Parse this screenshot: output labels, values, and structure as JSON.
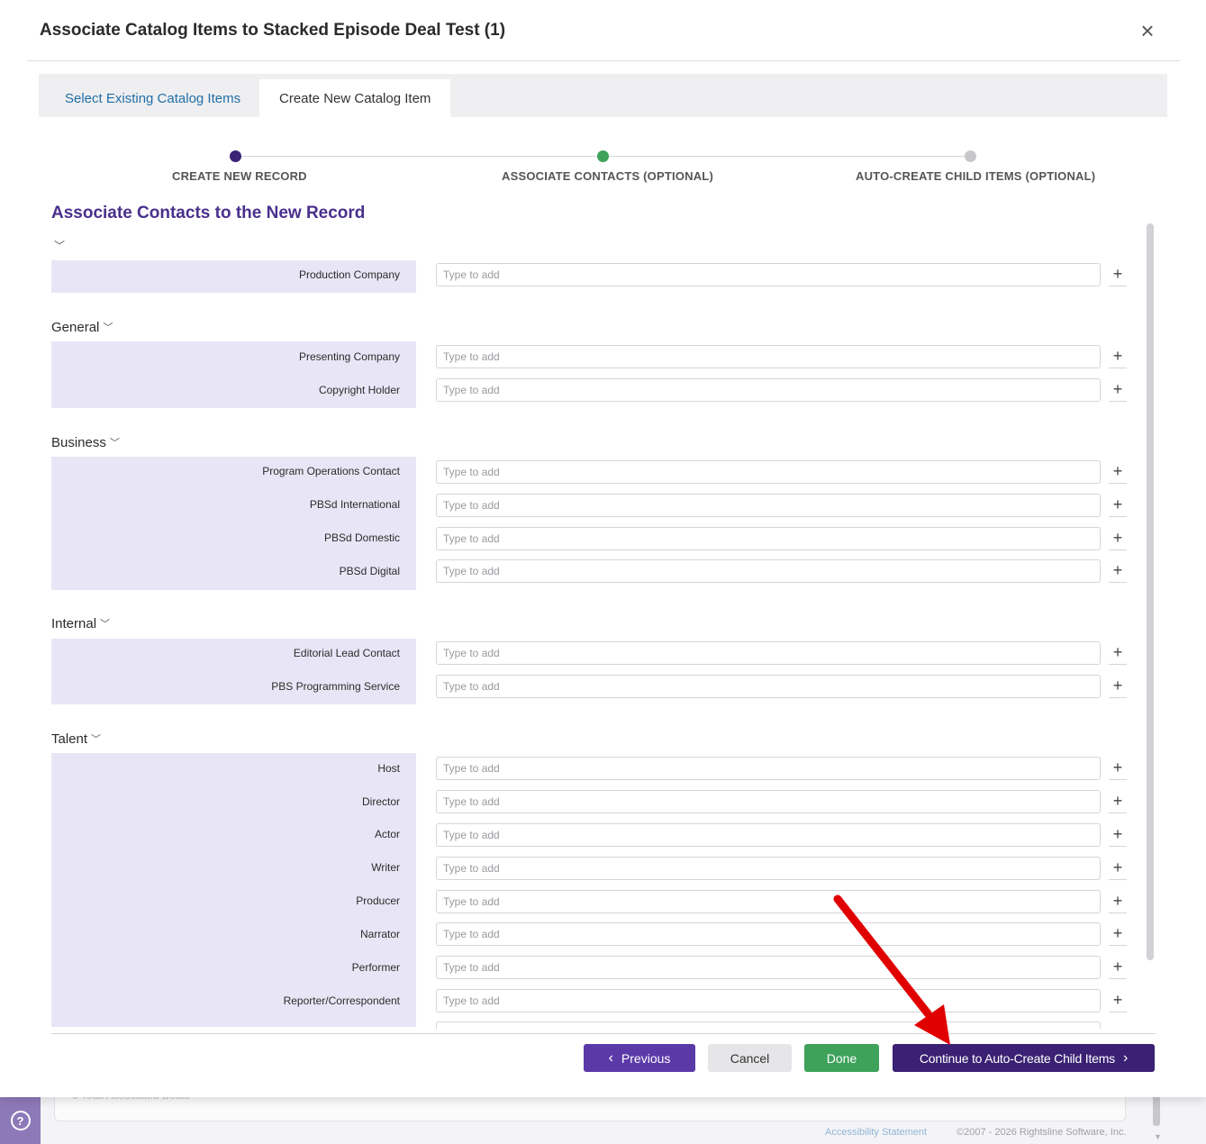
{
  "modal": {
    "title": "Associate Catalog Items to Stacked Episode Deal Test (1)",
    "close_icon": "close-icon"
  },
  "tabs": [
    {
      "label": "Select Existing Catalog Items",
      "active": false
    },
    {
      "label": "Create New Catalog Item",
      "active": true
    }
  ],
  "stepper": {
    "steps": [
      {
        "label": "CREATE NEW RECORD",
        "color": "#3b2478"
      },
      {
        "label": "ASSOCIATE CONTACTS (OPTIONAL)",
        "color": "#3ea25b"
      },
      {
        "label": "AUTO-CREATE CHILD ITEMS (OPTIONAL)",
        "color": "#c8c8cc"
      }
    ]
  },
  "section": {
    "heading": "Associate Contacts to the New Record"
  },
  "placeholder": "Type to add",
  "groups": {
    "ungrouped": {
      "rows": [
        "Production Company"
      ]
    },
    "general": {
      "title": "General",
      "rows": [
        "Presenting Company",
        "Copyright Holder"
      ]
    },
    "business": {
      "title": "Business",
      "rows": [
        "Program Operations Contact",
        "PBSd International",
        "PBSd Domestic",
        "PBSd Digital"
      ]
    },
    "internal": {
      "title": "Internal",
      "rows": [
        "Editorial Lead Contact",
        "PBS Programming Service"
      ]
    },
    "talent": {
      "title": "Talent",
      "rows": [
        "Host",
        "Director",
        "Actor",
        "Writer",
        "Producer",
        "Narrator",
        "Performer",
        "Reporter/Correspondent"
      ]
    }
  },
  "buttons": {
    "previous": "Previous",
    "cancel": "Cancel",
    "done": "Done",
    "continue": "Continue to Auto-Create Child Items"
  },
  "background": {
    "total_deals": "0 Total Associated Deals",
    "accessibility_link": "Accessibility Statement",
    "copyright": "©2007 - 2026 Rightsline Software, Inc."
  },
  "colors": {
    "brand_purple": "#3a2173",
    "accent_purple": "#5b3aa8",
    "success_green": "#3ea25b",
    "label_panel": "#e8e6f6",
    "annotation_arrow": "#e00000"
  }
}
